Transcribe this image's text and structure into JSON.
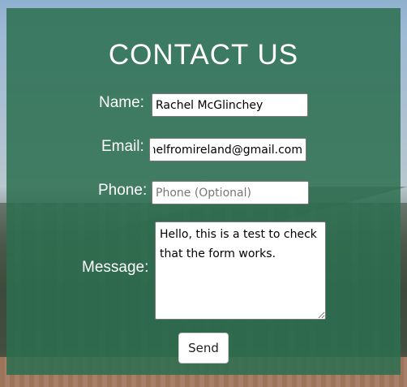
{
  "form": {
    "title": "CONTACT US",
    "name": {
      "label": "Name:",
      "value": "Rachel McGlinchey"
    },
    "email": {
      "label": "Email:",
      "value": "rachelfromireland@gmail.com"
    },
    "phone": {
      "label": "Phone:",
      "value": "",
      "placeholder": "Phone (Optional)"
    },
    "message": {
      "label": "Message:",
      "value": "Hello, this is a test to check that the form works."
    },
    "send_label": "Send"
  },
  "colors": {
    "overlay": "#2b6e50",
    "text": "#ffffff"
  }
}
